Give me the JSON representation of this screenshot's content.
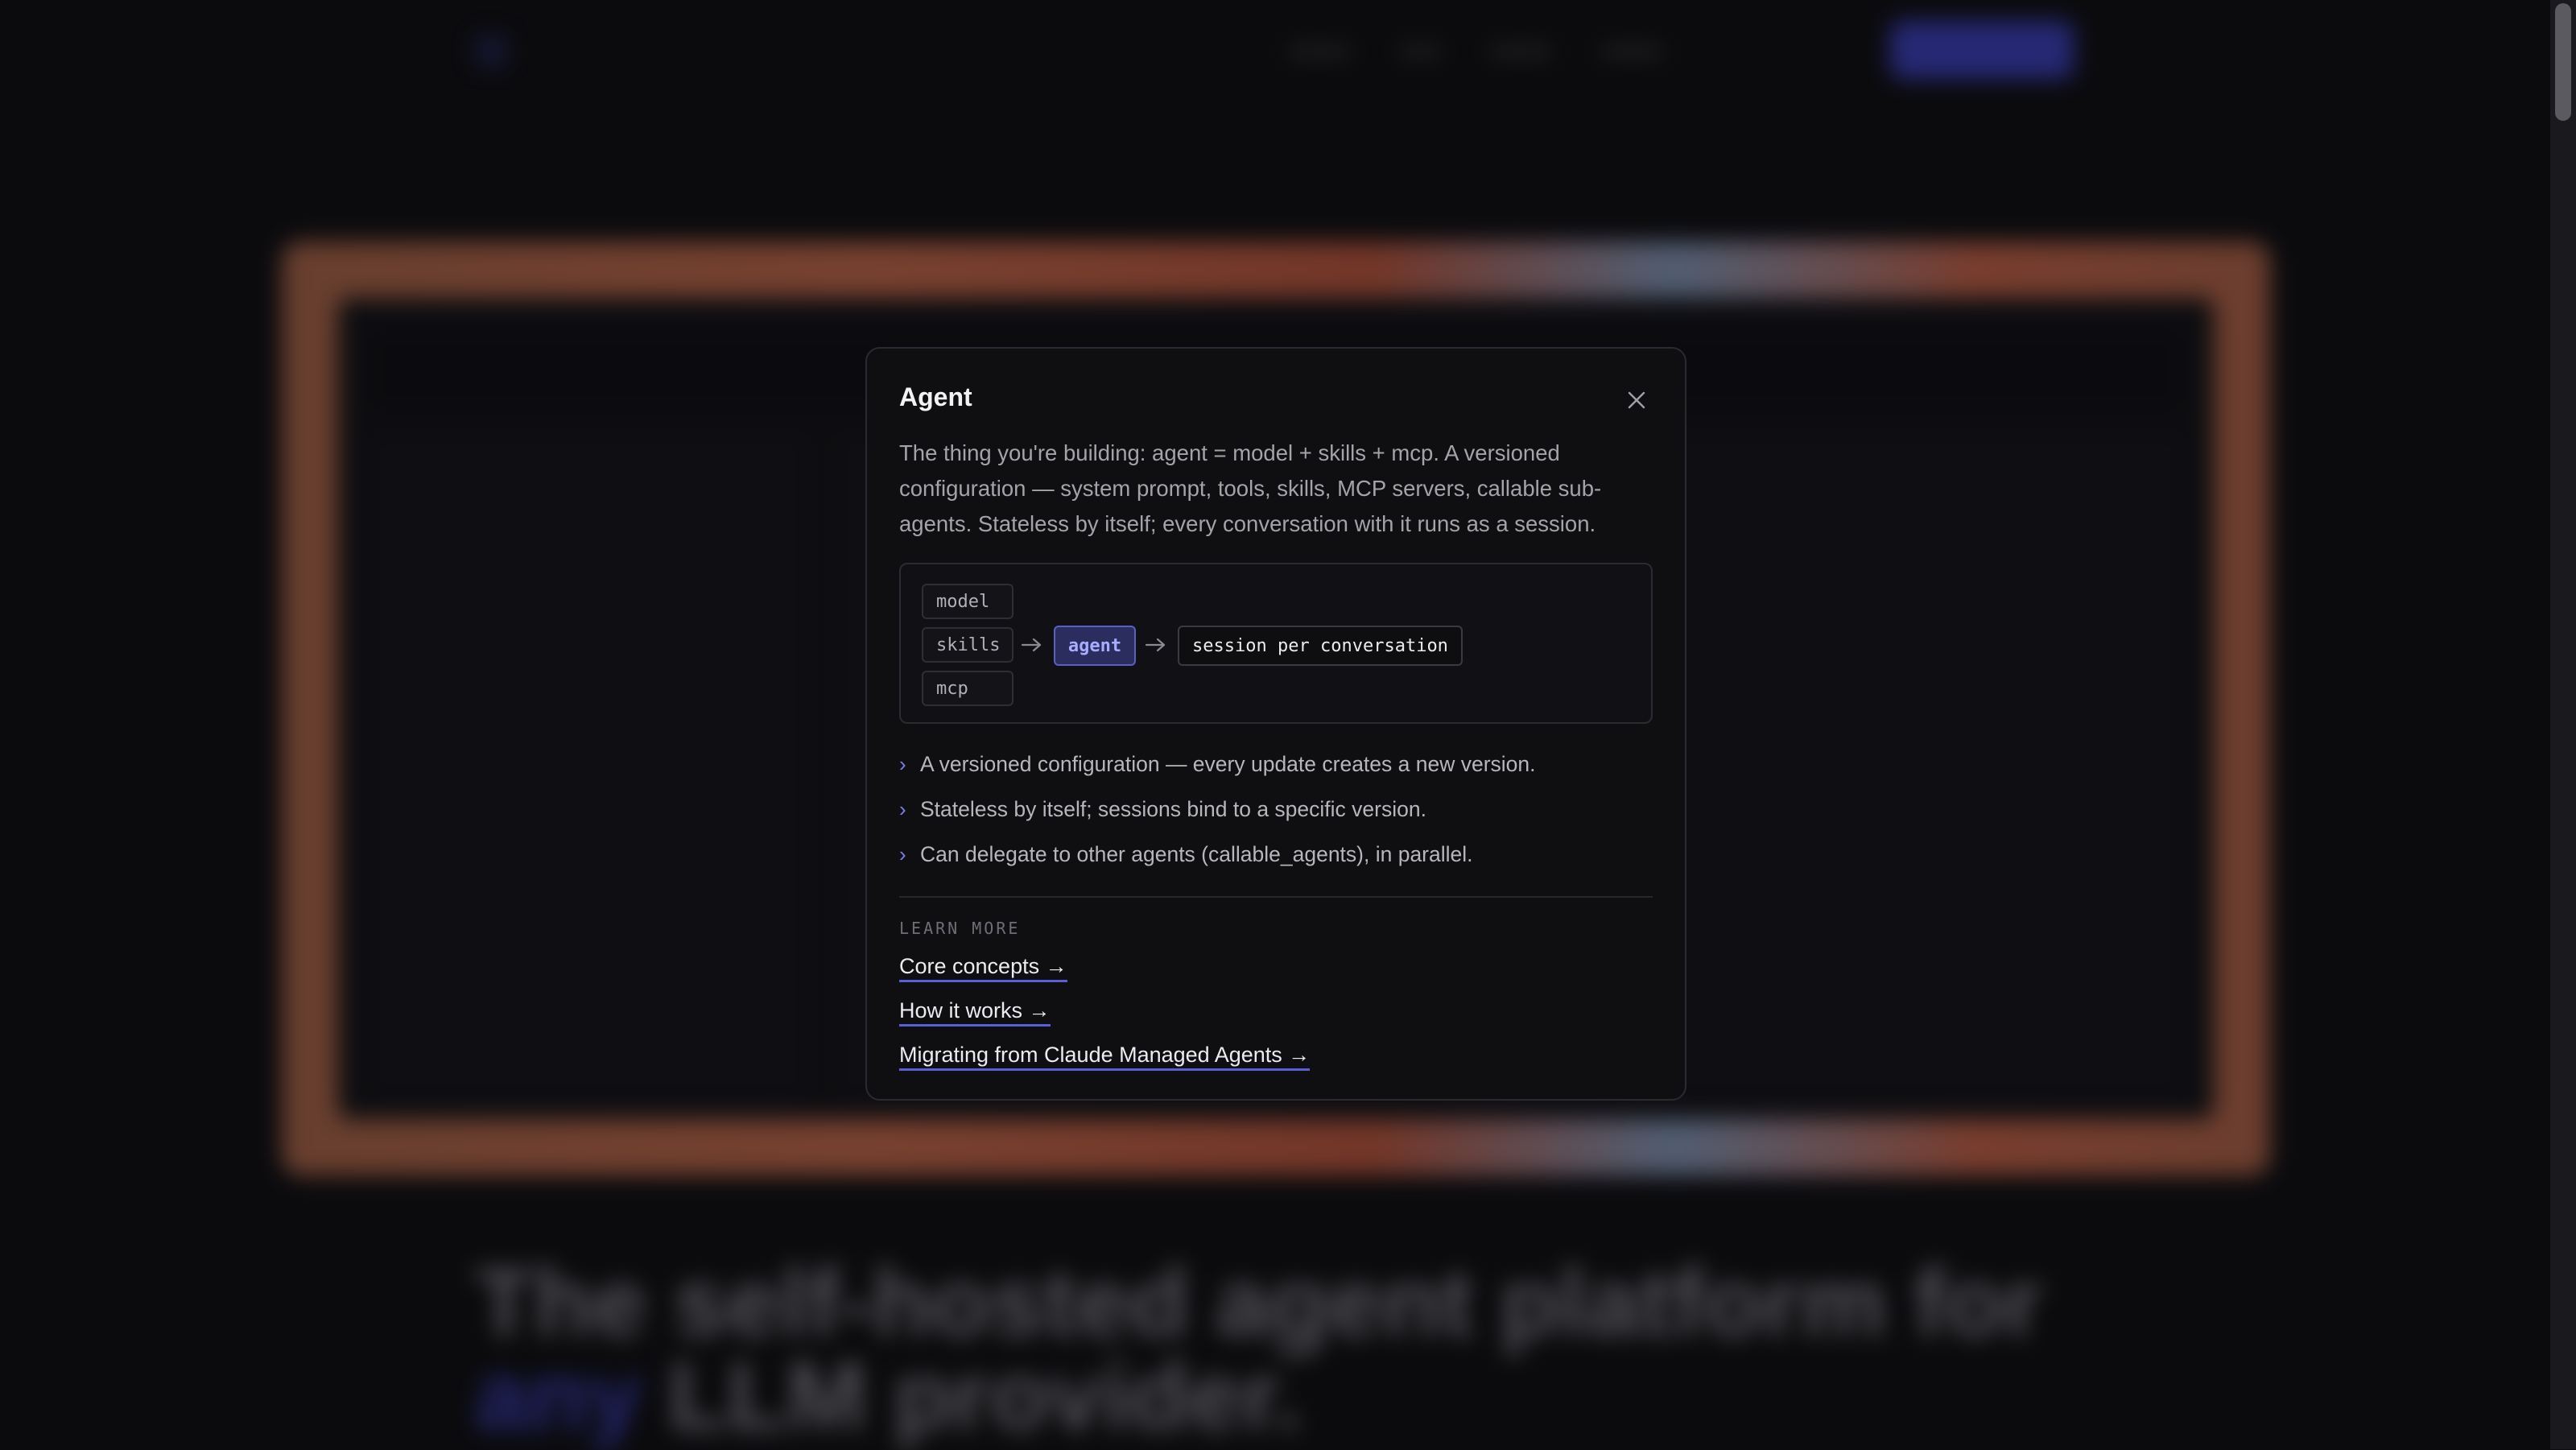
{
  "modal": {
    "title": "Agent",
    "description": "The thing you're building: agent = model + skills + mcp. A versioned configuration — system prompt, tools, skills, MCP servers, callable sub-agents. Stateless by itself; every conversation with it runs as a session.",
    "diagram": {
      "inputs": [
        "model",
        "skills",
        "mcp"
      ],
      "center": "agent",
      "output": "session per conversation"
    },
    "bullets": [
      "A versioned configuration — every update creates a new version.",
      "Stateless by itself; sessions bind to a specific version.",
      "Can delegate to other agents (callable_agents), in parallel."
    ],
    "learn_more_label": "LEARN MORE",
    "links": [
      "Core concepts →",
      "How it works →",
      "Migrating from Claude Managed Agents →"
    ]
  },
  "background": {
    "headline_part1": "The self-hosted agent platform for ",
    "headline_accent": "any",
    "headline_part2": " LLM provider."
  },
  "colors": {
    "accent": "#5a5fd8",
    "agent_chip_bg": "#2a2d5e",
    "modal_bg": "#0f0f12"
  },
  "icons": {
    "close": "close-icon",
    "arrow": "arrow-right-icon",
    "bullet": "chevron-right-icon"
  }
}
